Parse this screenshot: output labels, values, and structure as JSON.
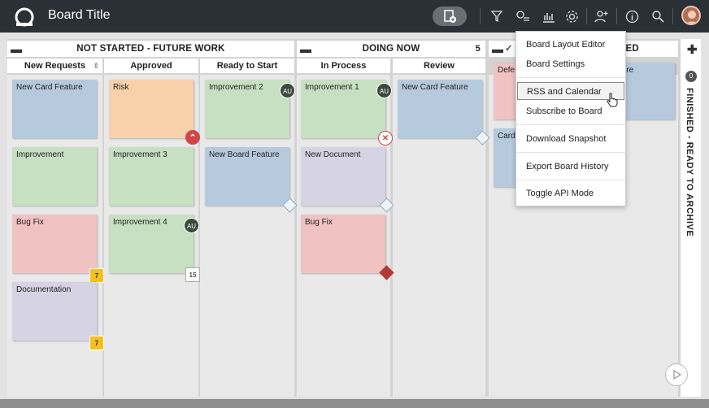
{
  "header": {
    "title": "Board Title",
    "icons": [
      "logo-icon",
      "add-card-icon",
      "filter-icon",
      "settings-list-icon",
      "analytics-icon",
      "gear-icon",
      "add-user-icon",
      "info-icon",
      "search-icon",
      "user-avatar"
    ]
  },
  "lanes": {
    "not_started": {
      "title": "NOT STARTED - FUTURE WORK"
    },
    "doing_now": {
      "title": "DOING NOW",
      "count": "5"
    },
    "finished_partial": {
      "title": "HED"
    },
    "finished": {
      "title": "FINISHED - READY TO ARCHIVE",
      "count": "0"
    }
  },
  "columns": {
    "new_requests": "New Requests",
    "approved": "Approved",
    "ready_to_start": "Ready to Start",
    "in_process": "In Process",
    "review": "Review"
  },
  "cards": {
    "c1": "New Card Feature",
    "c2": "Improvement",
    "c3": "Bug Fix",
    "c4": "Documentation",
    "c5": "Risk",
    "c6": "Improvement 3",
    "c7": "Improvement 4",
    "c8": "Improvement 2",
    "c9": "New Board Feature",
    "c10": "Improvement 1",
    "c11": "New Document",
    "c12": "Bug Fix",
    "c13": "New Card Feature",
    "c14": "Defe",
    "c15": "Card",
    "c16": "ture"
  },
  "avatars": {
    "initials": "AU"
  },
  "badges": {
    "cal7": "7",
    "cal15": "15"
  },
  "menu": {
    "items": [
      "Board Layout Editor",
      "Board Settings",
      "RSS and Calendar",
      "Subscribe to Board",
      "Download Snapshot",
      "Export Board History",
      "Toggle API Mode"
    ]
  },
  "colors": {
    "topbar": "#2b2f36",
    "blue": "#b6cadd",
    "green": "#c7e0c2",
    "red": "#f0c2c2",
    "purple": "#d5d3e4",
    "orange": "#f8d1aa",
    "date_badge": "#f4c01f"
  }
}
